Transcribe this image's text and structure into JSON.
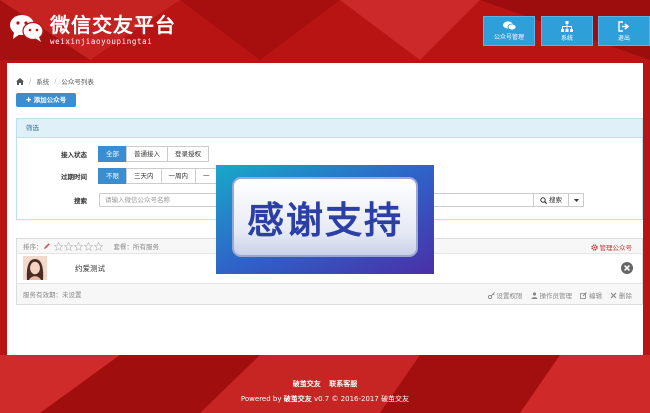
{
  "colors": {
    "primary": "#3a8ed0",
    "nav": "#2e9fd8",
    "background": "#b81414",
    "danger": "#c0392b"
  },
  "app": {
    "title": "微信交友平台",
    "subtitle": "weixinjiaoyoupingtai",
    "logo_icon": "wechat-icon"
  },
  "nav": [
    {
      "label": "公众号管理",
      "icon": "chat-bubbles-icon"
    },
    {
      "label": "系统",
      "icon": "sitemap-icon"
    },
    {
      "label": "退出",
      "icon": "sign-out-icon"
    }
  ],
  "breadcrumb": {
    "home_icon": "home-icon",
    "items": [
      "系统",
      "公众号列表"
    ],
    "separator": "/"
  },
  "add_button": {
    "label": "添加公众号",
    "icon": "plus-icon"
  },
  "filter": {
    "title": "筛选",
    "access": {
      "label": "接入状态",
      "options": [
        "全部",
        "普通接入",
        "登录授权"
      ],
      "selected": "全部"
    },
    "expire": {
      "label": "过期时间",
      "options": [
        "不限",
        "三天内",
        "一周内",
        "一"
      ],
      "selected": "不限"
    },
    "search": {
      "label": "搜索",
      "placeholder": "请输入微信公众号名称",
      "button": "搜索",
      "button_icon": "search-icon"
    }
  },
  "account": {
    "sort_label": "排序：",
    "rating": 0,
    "rating_max": 5,
    "meta_link": "套餐：所有服务",
    "manage_label": "管理公众号",
    "name": "约爱测试",
    "validity": "服务有效期：未设置",
    "actions": [
      {
        "label": "设置权限",
        "icon": "key-icon"
      },
      {
        "label": "操作员管理",
        "icon": "user-icon"
      },
      {
        "label": "编辑",
        "icon": "edit-icon"
      },
      {
        "label": "删除",
        "icon": "close-icon"
      }
    ]
  },
  "overlay": {
    "text": "感谢支持"
  },
  "footer": {
    "links": [
      "破茧交友",
      "联系客服"
    ],
    "powered_prefix": "Powered by ",
    "powered_brand": "破茧交友",
    "powered_suffix": " v0.7 © 2016-2017 ",
    "powered_owner": "破茧交友"
  }
}
